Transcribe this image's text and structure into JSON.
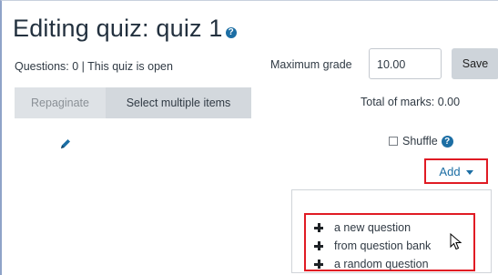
{
  "header": {
    "title": "Editing quiz: quiz 1",
    "help_icon_glyph": "?"
  },
  "status": {
    "text": "Questions: 0 | This quiz is open"
  },
  "grade": {
    "label": "Maximum grade",
    "value": "10.00",
    "save_label": "Save"
  },
  "toolbar": {
    "repaginate_label": "Repaginate",
    "select_multiple_label": "Select multiple items"
  },
  "total_marks": {
    "text": "Total of marks: 0.00"
  },
  "section": {
    "edit_icon": "pencil-icon",
    "shuffle_label": "Shuffle",
    "shuffle_checked": false,
    "help_icon_glyph": "?"
  },
  "add_menu": {
    "label": "Add",
    "items": [
      {
        "label": "a new question",
        "icon": "plus-icon"
      },
      {
        "label": "from question bank",
        "icon": "plus-icon"
      },
      {
        "label": "a random question",
        "icon": "plus-icon"
      }
    ]
  },
  "colors": {
    "link": "#1c6ea4",
    "highlight": "#e01b24",
    "button_bg": "#ced4da"
  }
}
